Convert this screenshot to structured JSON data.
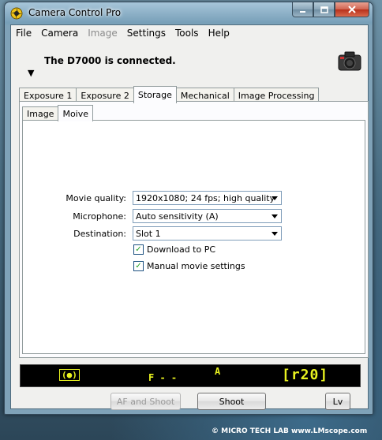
{
  "window": {
    "title": "Camera Control Pro"
  },
  "menu": [
    {
      "label": "File",
      "enabled": true
    },
    {
      "label": "Camera",
      "enabled": true
    },
    {
      "label": "Image",
      "enabled": false
    },
    {
      "label": "Settings",
      "enabled": true
    },
    {
      "label": "Tools",
      "enabled": true
    },
    {
      "label": "Help",
      "enabled": true
    }
  ],
  "status": {
    "message": "The D7000 is connected.",
    "marker": "▼"
  },
  "tabs": [
    "Exposure 1",
    "Exposure 2",
    "Storage",
    "Mechanical",
    "Image Processing"
  ],
  "active_tab": "Storage",
  "subtabs": [
    "Image",
    "Moive"
  ],
  "active_subtab": "Moive",
  "settings": {
    "movie_quality": {
      "label": "Movie quality:",
      "value": "1920x1080; 24 fps; high quality"
    },
    "microphone": {
      "label": "Microphone:",
      "value": "Auto sensitivity (A)"
    },
    "destination": {
      "label": "Destination:",
      "value": "Slot 1"
    },
    "download_to_pc": {
      "label": "Download to PC",
      "checked": true,
      "mark": "✓"
    },
    "manual_movie": {
      "label": "Manual movie settings",
      "checked": true,
      "mark": "✓"
    }
  },
  "lcd": {
    "icon": "(●)",
    "f_value": "F - -",
    "mode": "A",
    "remaining": "[r20]",
    "color": "#e9f21f"
  },
  "buttons": {
    "af_shoot": "AF and Shoot",
    "shoot": "Shoot",
    "lv": "Lv"
  },
  "watermark": "© MICRO TECH LAB  www.LMscope.com"
}
